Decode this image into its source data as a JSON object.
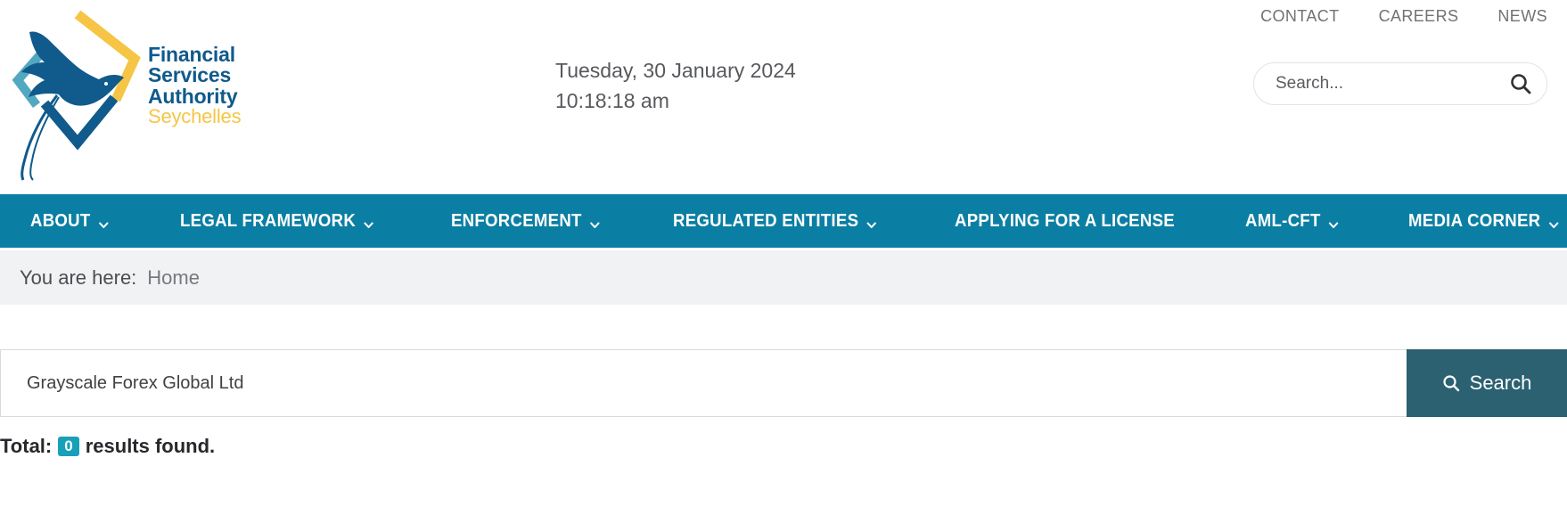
{
  "colors": {
    "nav_teal": "#0b7fa3",
    "button_teal": "#2b6170",
    "badge_teal": "#18a0b8",
    "logo_blue": "#105a8c",
    "logo_yellow": "#f6c546",
    "logo_lightblue": "#52a8c0",
    "breadcrumb_bg": "#f1f2f4"
  },
  "header": {
    "top_links": [
      {
        "label": "CONTACT",
        "name": "contact"
      },
      {
        "label": "CAREERS",
        "name": "careers"
      },
      {
        "label": "NEWS",
        "name": "news"
      }
    ],
    "logo": {
      "line1": "Financial",
      "line2": "Services",
      "line3": "Authority",
      "line4": "Seychelles",
      "icon": "flying-bird-diamond-logo"
    },
    "datetime": {
      "date": "Tuesday, 30 January 2024",
      "time": "10:18:18 am"
    },
    "search": {
      "placeholder": "Search...",
      "value": "",
      "icon": "search-icon"
    }
  },
  "nav": {
    "items": [
      {
        "label": "ABOUT",
        "has_dropdown": true
      },
      {
        "label": "LEGAL FRAMEWORK",
        "has_dropdown": true
      },
      {
        "label": "ENFORCEMENT",
        "has_dropdown": true
      },
      {
        "label": "REGULATED ENTITIES",
        "has_dropdown": true
      },
      {
        "label": "APPLYING FOR A LICENSE",
        "has_dropdown": false
      },
      {
        "label": "AML-CFT",
        "has_dropdown": true
      },
      {
        "label": "MEDIA CORNER",
        "has_dropdown": true
      }
    ]
  },
  "breadcrumb": {
    "label": "You are here:",
    "current": "Home"
  },
  "main": {
    "search_form": {
      "value": "Grayscale Forex Global Ltd",
      "placeholder": "",
      "button_label": "Search",
      "button_icon": "search-icon"
    },
    "results": {
      "prefix": "Total:",
      "count": "0",
      "suffix": "results found."
    }
  }
}
